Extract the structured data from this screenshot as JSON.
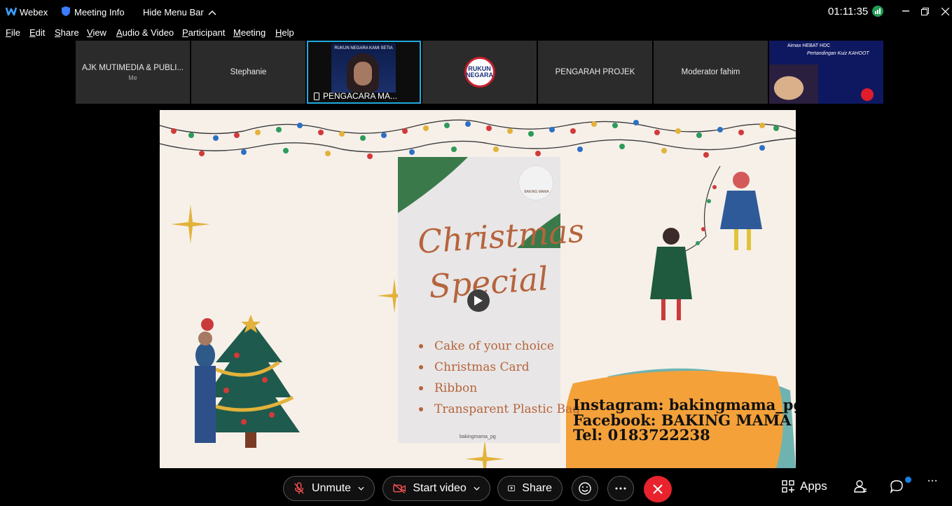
{
  "titlebar": {
    "app_name": "Webex",
    "meeting_info": "Meeting Info",
    "hide_menu": "Hide Menu Bar",
    "clock": "01:11:35"
  },
  "menu": [
    "File",
    "Edit",
    "Share",
    "View",
    "Audio & Video",
    "Participant",
    "Meeting",
    "Help"
  ],
  "participants": [
    {
      "name": "AJK MUTIMEDIA & PUBLI...",
      "sub": "Me"
    },
    {
      "name": "Stephanie"
    },
    {
      "name": "PENGACARA MA...",
      "camera_text": "RUKUN NEGARA KAMI SETIA"
    },
    {
      "logo_line1": "RUKUN",
      "logo_line2": "NEGARA"
    },
    {
      "name": "PENGARAH PROJEK"
    },
    {
      "name": "Moderator fahim"
    },
    {
      "poster_header": "Aimax  HEBAT  HDC",
      "poster_title": "Pertandingan Kuiz KAHOOT"
    }
  ],
  "slide": {
    "card_logo_text": "BAKING MAMA",
    "title_line1": "Christmas",
    "title_line2": "Special",
    "bullets": [
      "Cake of your choice",
      "Christmas Card",
      "Ribbon",
      "Transparent Plastic Bag"
    ],
    "card_footer": "bakingmama_pg",
    "contact": [
      "Instagram: bakingmama_pg",
      "Facebook: BAKING MAMA",
      "Tel: 0183722238"
    ]
  },
  "toolbar": {
    "unmute": "Unmute",
    "start_video": "Start video",
    "share": "Share",
    "apps": "Apps"
  },
  "colors": {
    "active_border": "#20a9e0",
    "end_call": "#e8232d",
    "slide_text": "#b5643d",
    "badge": "#1a7fe0"
  }
}
